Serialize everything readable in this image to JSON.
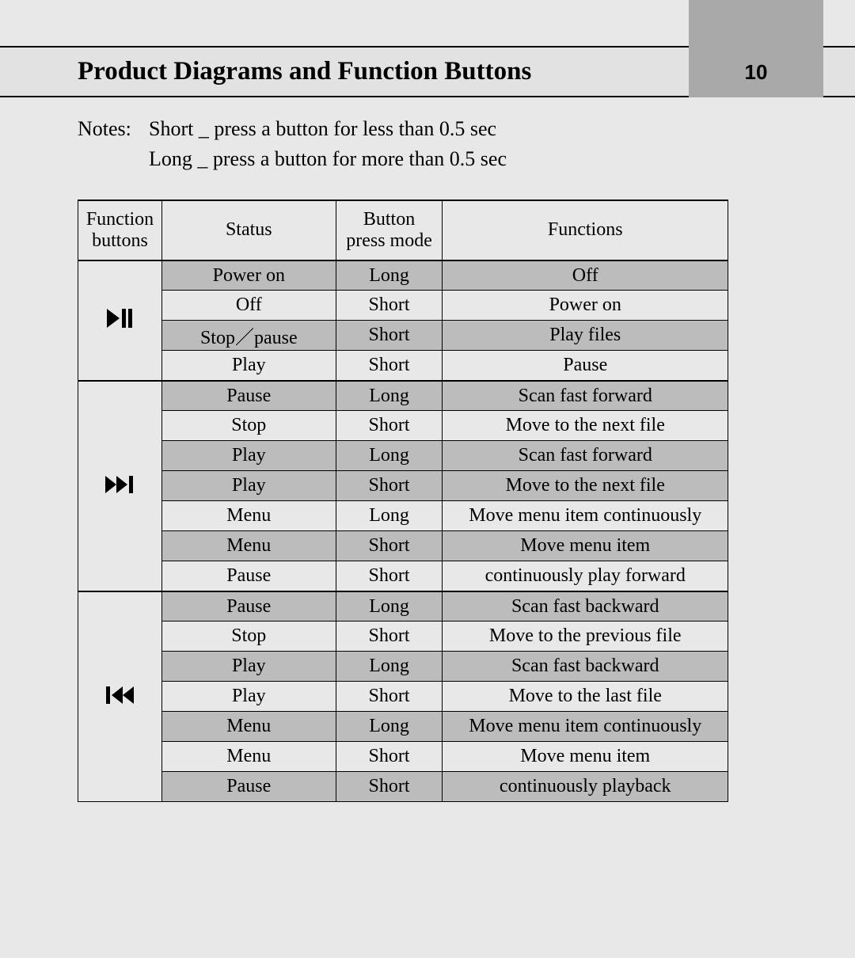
{
  "header": {
    "title": "Product Diagrams and Function Buttons",
    "page_number": "10"
  },
  "notes": {
    "label": "Notes:",
    "line1": "Short _ press a button for less than 0.5 sec",
    "line2": "Long _ press a button for more than 0.5 sec"
  },
  "table": {
    "headers": {
      "function_buttons_l1": "Function",
      "function_buttons_l2": "buttons",
      "status": "Status",
      "press_mode_l1": "Button",
      "press_mode_l2": "press mode",
      "functions": "Functions"
    },
    "group1": {
      "icon": "play-pause",
      "rows": [
        {
          "status": "Power on",
          "mode": "Long",
          "fn": "Off",
          "shaded": true
        },
        {
          "status": "Off",
          "mode": "Short",
          "fn": "Power on",
          "shaded": false
        },
        {
          "status": "Stop／pause",
          "mode": "Short",
          "fn": "Play files",
          "shaded": true
        },
        {
          "status": "Play",
          "mode": "Short",
          "fn": "Pause",
          "shaded": false
        }
      ]
    },
    "group2": {
      "icon": "next",
      "rows": [
        {
          "status": "Pause",
          "mode": "Long",
          "fn": "Scan fast forward",
          "shaded": true
        },
        {
          "status": "Stop",
          "mode": "Short",
          "fn": "Move to the next file",
          "shaded": false
        },
        {
          "status": "Play",
          "mode": "Long",
          "fn": "Scan fast forward",
          "shaded": true
        },
        {
          "status": "Play",
          "mode": "Short",
          "fn": "Move to the next file",
          "shaded": true
        },
        {
          "status": "Menu",
          "mode": "Long",
          "fn": "Move menu item continuously",
          "shaded": false
        },
        {
          "status": "Menu",
          "mode": "Short",
          "fn": "Move menu item",
          "shaded": true
        },
        {
          "status": "Pause",
          "mode": "Short",
          "fn": "continuously play forward",
          "shaded": false
        }
      ]
    },
    "group3": {
      "icon": "prev",
      "rows": [
        {
          "status": "Pause",
          "mode": "Long",
          "fn": "Scan fast backward",
          "shaded": true
        },
        {
          "status": "Stop",
          "mode": "Short",
          "fn": "Move to the previous file",
          "shaded": false
        },
        {
          "status": "Play",
          "mode": "Long",
          "fn": "Scan fast backward",
          "shaded": true
        },
        {
          "status": "Play",
          "mode": "Short",
          "fn": "Move to the last file",
          "shaded": false
        },
        {
          "status": "Menu",
          "mode": "Long",
          "fn": "Move menu item continuously",
          "shaded": true
        },
        {
          "status": "Menu",
          "mode": "Short",
          "fn": "Move menu item",
          "shaded": false
        },
        {
          "status": "Pause",
          "mode": "Short",
          "fn": "continuously playback",
          "shaded": true
        }
      ]
    }
  }
}
